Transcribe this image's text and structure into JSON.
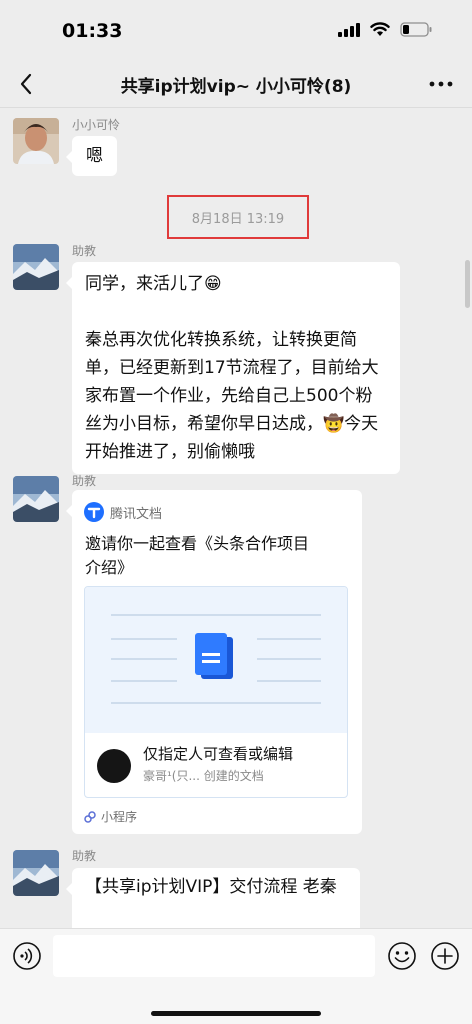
{
  "status": {
    "time": "01:33"
  },
  "nav": {
    "title": "共享ip计划vip~ 小小可怜(8)"
  },
  "messages": [
    {
      "sender": "小小可怜",
      "text": "嗯"
    },
    {
      "timestamp": "8月18日 13:19"
    },
    {
      "sender": "助教",
      "paragraphs": [
        "同学，来活儿了😁",
        "秦总再次优化转换系统，让转换更简单，已经更新到17节流程了，目前给大家布置一个作业，先给自己上500个粉丝为小目标，希望你早日达成，🤠今天开始推进了，别偷懒哦"
      ]
    },
    {
      "sender": "助教",
      "card": {
        "app": "腾讯文档",
        "title": "邀请你一起查看《头条合作项目介绍》",
        "permission": "仅指定人可查看或编辑",
        "owner": "豪哥¹(只... 创建的文档",
        "footer": "小程序"
      }
    },
    {
      "sender": "助教",
      "text": "【共享ip计划VIP】交付流程 老秦"
    }
  ],
  "colors": {
    "background": "#ededed",
    "bubble": "#ffffff",
    "highlight_border": "#e03a3a",
    "doc_blue": "#1e6fff"
  },
  "icons": [
    "signal-icon",
    "wifi-icon",
    "battery-icon",
    "back-icon",
    "more-icon",
    "tencent-docs-icon",
    "document-icon",
    "mini-program-icon",
    "voice-icon",
    "emoji-icon",
    "plus-icon"
  ]
}
